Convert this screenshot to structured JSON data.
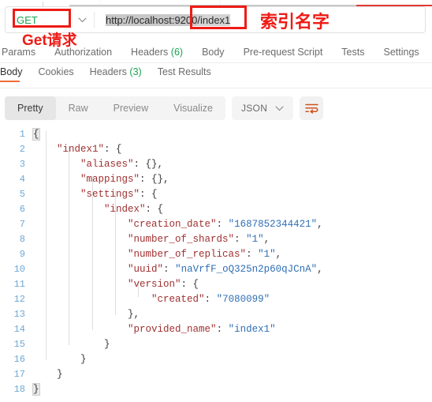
{
  "request": {
    "method": "GET",
    "method_caret_icon": "chevron-down-icon",
    "url_prefix": "http://localhost:9200",
    "url_index": "/index1",
    "url_full": "http://localhost:9200/index1"
  },
  "annotations": {
    "method_note": "Get请求",
    "index_note": "索引名字",
    "box_color": "#ee1b16"
  },
  "request_tabs": [
    {
      "label": "Params",
      "count": ""
    },
    {
      "label": "Authorization",
      "count": ""
    },
    {
      "label": "Headers",
      "count": "(6)"
    },
    {
      "label": "Body",
      "count": ""
    },
    {
      "label": "Pre-request Script",
      "count": ""
    },
    {
      "label": "Tests",
      "count": ""
    },
    {
      "label": "Settings",
      "count": ""
    }
  ],
  "response_tabs": [
    {
      "label": "Body",
      "count": "",
      "active": true
    },
    {
      "label": "Cookies",
      "count": "",
      "active": false
    },
    {
      "label": "Headers",
      "count": "(3)",
      "active": false
    },
    {
      "label": "Test Results",
      "count": "",
      "active": false
    }
  ],
  "viewer": {
    "modes": [
      "Pretty",
      "Raw",
      "Preview",
      "Visualize"
    ],
    "active_mode": "Pretty",
    "format": "JSON",
    "format_caret_icon": "chevron-down-icon",
    "wrap_icon": "word-wrap-icon",
    "accent_color": "#ef6c34"
  },
  "body_json": {
    "lines": [
      {
        "n": "1",
        "tokens": [
          {
            "t": "{",
            "c": "p hl"
          }
        ]
      },
      {
        "n": "2",
        "tokens": [
          {
            "t": "    ",
            "c": "p"
          },
          {
            "t": "\"index1\"",
            "c": "k"
          },
          {
            "t": ": {",
            "c": "p"
          }
        ]
      },
      {
        "n": "3",
        "tokens": [
          {
            "t": "        ",
            "c": "p"
          },
          {
            "t": "\"aliases\"",
            "c": "k"
          },
          {
            "t": ": {},",
            "c": "p"
          }
        ]
      },
      {
        "n": "4",
        "tokens": [
          {
            "t": "        ",
            "c": "p"
          },
          {
            "t": "\"mappings\"",
            "c": "k"
          },
          {
            "t": ": {},",
            "c": "p"
          }
        ]
      },
      {
        "n": "5",
        "tokens": [
          {
            "t": "        ",
            "c": "p"
          },
          {
            "t": "\"settings\"",
            "c": "k"
          },
          {
            "t": ": {",
            "c": "p"
          }
        ]
      },
      {
        "n": "6",
        "tokens": [
          {
            "t": "            ",
            "c": "p"
          },
          {
            "t": "\"index\"",
            "c": "k"
          },
          {
            "t": ": {",
            "c": "p"
          }
        ]
      },
      {
        "n": "7",
        "tokens": [
          {
            "t": "                ",
            "c": "p"
          },
          {
            "t": "\"creation_date\"",
            "c": "k"
          },
          {
            "t": ": ",
            "c": "p"
          },
          {
            "t": "\"1687852344421\"",
            "c": "s"
          },
          {
            "t": ",",
            "c": "p"
          }
        ]
      },
      {
        "n": "8",
        "tokens": [
          {
            "t": "                ",
            "c": "p"
          },
          {
            "t": "\"number_of_shards\"",
            "c": "k"
          },
          {
            "t": ": ",
            "c": "p"
          },
          {
            "t": "\"1\"",
            "c": "s"
          },
          {
            "t": ",",
            "c": "p"
          }
        ]
      },
      {
        "n": "9",
        "tokens": [
          {
            "t": "                ",
            "c": "p"
          },
          {
            "t": "\"number_of_replicas\"",
            "c": "k"
          },
          {
            "t": ": ",
            "c": "p"
          },
          {
            "t": "\"1\"",
            "c": "s"
          },
          {
            "t": ",",
            "c": "p"
          }
        ]
      },
      {
        "n": "10",
        "tokens": [
          {
            "t": "                ",
            "c": "p"
          },
          {
            "t": "\"uuid\"",
            "c": "k"
          },
          {
            "t": ": ",
            "c": "p"
          },
          {
            "t": "\"naVrfF_oQ325n2p60qJCnA\"",
            "c": "s"
          },
          {
            "t": ",",
            "c": "p"
          }
        ]
      },
      {
        "n": "11",
        "tokens": [
          {
            "t": "                ",
            "c": "p"
          },
          {
            "t": "\"version\"",
            "c": "k"
          },
          {
            "t": ": {",
            "c": "p"
          }
        ]
      },
      {
        "n": "12",
        "tokens": [
          {
            "t": "                    ",
            "c": "p"
          },
          {
            "t": "\"created\"",
            "c": "k"
          },
          {
            "t": ": ",
            "c": "p"
          },
          {
            "t": "\"7080099\"",
            "c": "s"
          }
        ]
      },
      {
        "n": "13",
        "tokens": [
          {
            "t": "                },",
            "c": "p"
          }
        ]
      },
      {
        "n": "14",
        "tokens": [
          {
            "t": "                ",
            "c": "p"
          },
          {
            "t": "\"provided_name\"",
            "c": "k"
          },
          {
            "t": ": ",
            "c": "p"
          },
          {
            "t": "\"index1\"",
            "c": "s"
          }
        ]
      },
      {
        "n": "15",
        "tokens": [
          {
            "t": "            }",
            "c": "p"
          }
        ]
      },
      {
        "n": "16",
        "tokens": [
          {
            "t": "        }",
            "c": "p"
          }
        ]
      },
      {
        "n": "17",
        "tokens": [
          {
            "t": "    }",
            "c": "p"
          }
        ]
      },
      {
        "n": "18",
        "tokens": [
          {
            "t": "}",
            "c": "p hl"
          }
        ]
      }
    ]
  }
}
